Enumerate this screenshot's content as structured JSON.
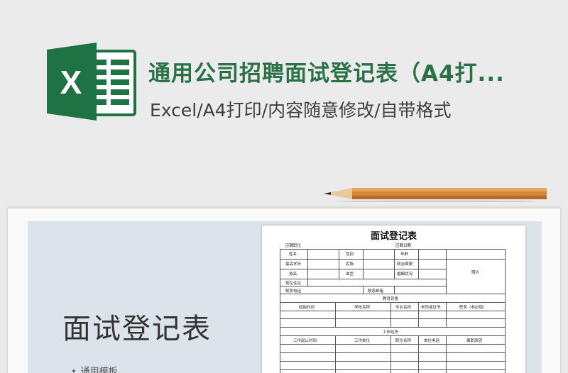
{
  "banner": {
    "title": "通用公司招聘面试登记表（A4打...",
    "subtitle": "Excel/A4打印/内容随意修改/自带格式",
    "logo_letter": "X",
    "brand_color": "#1f7244",
    "title_color": "#2a7146"
  },
  "board": {
    "heading": "面试登记表",
    "tag": "通用模板"
  },
  "form": {
    "title": "面试登记表",
    "header_left": "应聘职位",
    "header_right": "应聘日期",
    "row1": [
      "姓名",
      "性别",
      "年龄"
    ],
    "row2": [
      "最高学历",
      "民族",
      "政治面貌"
    ],
    "row3": [
      "身高",
      "血型",
      "婚姻状况"
    ],
    "photo": "照片",
    "address": "现在住址",
    "phone": "联系电话",
    "email": "联系邮箱",
    "edu_section": "教育背景",
    "edu_cols": [
      "起始时间",
      "学校名称",
      "专业名称",
      "学历或证书",
      "职务（非必填）"
    ],
    "work_section": "工作经历",
    "work_cols": [
      "工作起止时间",
      "工作单位",
      "职位名称",
      "单位电话",
      "离职原因"
    ]
  }
}
